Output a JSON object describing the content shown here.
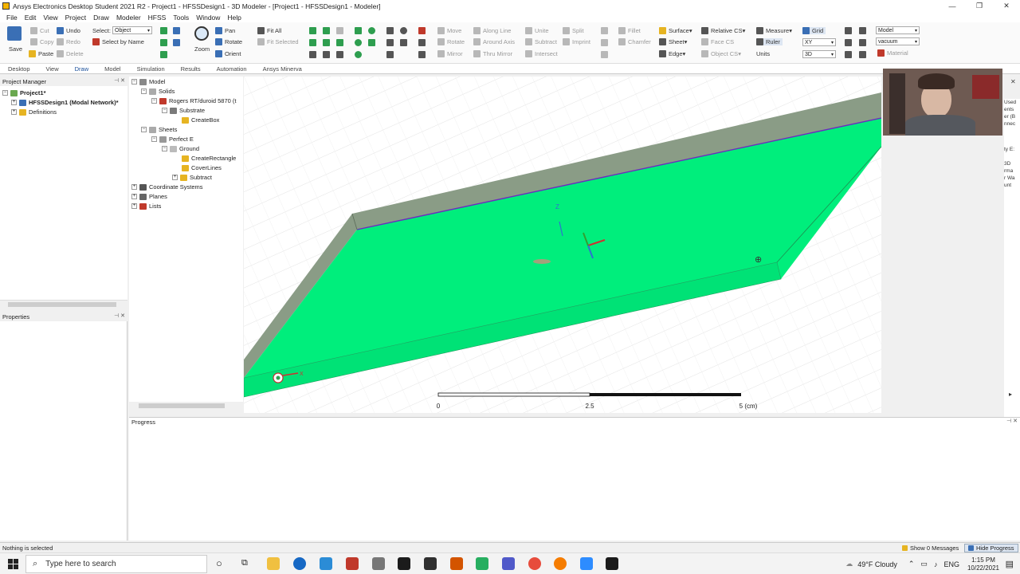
{
  "window": {
    "title": "Ansys Electronics Desktop Student 2021 R2 - Project1 - HFSSDesign1 - 3D Modeler - [Project1 - HFSSDesign1 - Modeler]",
    "minimize": "—",
    "restore": "❐",
    "close": "✕"
  },
  "menu": [
    "File",
    "Edit",
    "View",
    "Project",
    "Draw",
    "Modeler",
    "HFSS",
    "Tools",
    "Window",
    "Help"
  ],
  "ribbon": {
    "save": "Save",
    "cut": "Cut",
    "copy": "Copy",
    "paste": "Paste",
    "undo": "Undo",
    "redo": "Redo",
    "delete": "Delete",
    "select_label": "Select:",
    "select_value": "Object",
    "select_by_name": "Select by Name",
    "zoom": "Zoom",
    "pan": "Pan",
    "rotate": "Rotate",
    "orient": "Orient",
    "fit_all": "Fit All",
    "fit_selected": "Fit Selected",
    "move": "Move",
    "rotate2": "Rotate",
    "mirror": "Mirror",
    "along_line": "Along Line",
    "around_axis": "Around Axis",
    "thru_mirror": "Thru Mirror",
    "unite": "Unite",
    "subtract": "Subtract",
    "intersect": "Intersect",
    "split": "Split",
    "imprint": "Imprint",
    "fillet": "Fillet",
    "chamfer": "Chamfer",
    "surface": "Surface",
    "sheet": "Sheet",
    "edge": "Edge",
    "relative_cs": "Relative CS",
    "face_cs": "Face CS",
    "object_cs": "Object CS",
    "measure": "Measure",
    "ruler": "Ruler",
    "units": "Units",
    "grid": "Grid",
    "plane_value": "XY",
    "dim_value": "3D",
    "model_value": "Model",
    "material_value": "vacuum",
    "material": "Material"
  },
  "tabs": [
    "Desktop",
    "View",
    "Draw",
    "Model",
    "Simulation",
    "Results",
    "Automation",
    "Ansys Minerva"
  ],
  "project_manager": {
    "header": "Project Manager",
    "project": "Project1*",
    "design": "HFSSDesign1 (Modal Network)*",
    "definitions": "Definitions"
  },
  "properties_header": "Properties",
  "model_tree": {
    "model": "Model",
    "solids": "Solids",
    "material": "Rogers RT/duroid 5870 (t",
    "substrate": "Substrate",
    "createbox": "CreateBox",
    "sheets": "Sheets",
    "perfect_e": "Perfect E",
    "ground": "Ground",
    "createrectangle": "CreateRectangle",
    "coverlines": "CoverLines",
    "subtract": "Subtract",
    "coordinate_systems": "Coordinate Systems",
    "planes": "Planes",
    "lists": "Lists"
  },
  "viewport": {
    "scale_labels": [
      "0",
      "2.5",
      "5 (cm)"
    ],
    "axis_z": "Z",
    "axis_x": "X"
  },
  "progress_header": "Progress",
  "right_side_text": [
    "Used",
    "ents",
    "er (B",
    "nnec",
    "ty E:",
    "3D",
    "rma",
    "r Wa",
    "unt"
  ],
  "status": {
    "text": "Nothing is selected",
    "show_messages": "Show 0 Messages",
    "hide_progress": "Hide Progress"
  },
  "taskbar": {
    "search_placeholder": "Type here to search",
    "weather": "49°F  Cloudy",
    "lang": "ENG",
    "time": "1:15 PM",
    "date": "10/22/2021"
  }
}
